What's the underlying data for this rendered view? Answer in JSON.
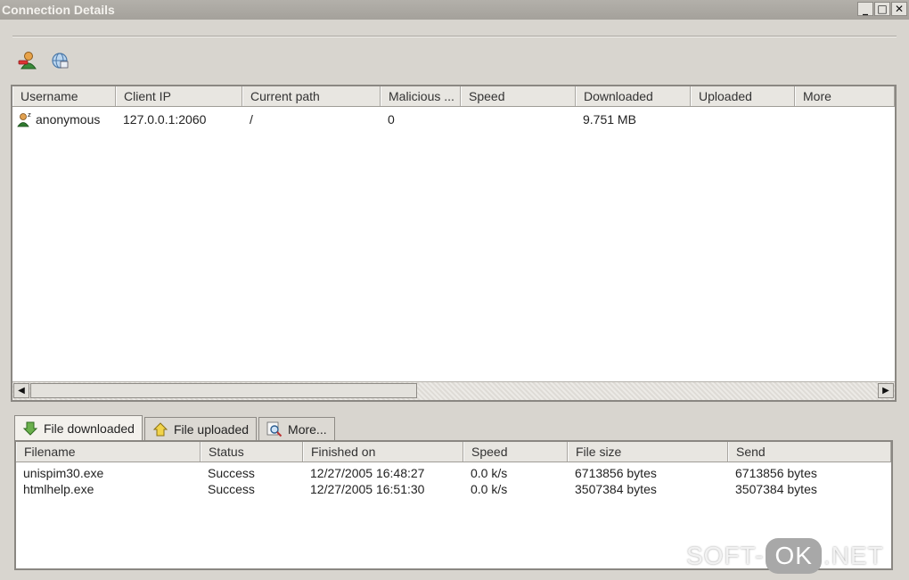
{
  "window": {
    "title": "Connection Details",
    "buttons": {
      "minimize": "_",
      "maximize": "□",
      "close": "✕"
    }
  },
  "toolbar": [
    {
      "icon": "disconnect-user-icon"
    },
    {
      "icon": "refresh-connection-icon"
    }
  ],
  "connections": {
    "columns": [
      "Username",
      "Client IP",
      "Current path",
      "Malicious ...",
      "Speed",
      "Downloaded",
      "Uploaded",
      "More"
    ],
    "rows": [
      {
        "username": "anonymous",
        "client_ip": "127.0.0.1:2060",
        "current_path": "/",
        "malicious": "0",
        "speed": "",
        "downloaded": "9.751 MB",
        "uploaded": "",
        "more": ""
      }
    ],
    "scrollbar": {
      "left": "◀",
      "right": "▶"
    }
  },
  "tabs": [
    {
      "label": "File downloaded",
      "icon": "download-arrow-icon",
      "active": true
    },
    {
      "label": "File uploaded",
      "icon": "upload-arrow-icon",
      "active": false
    },
    {
      "label": "More...",
      "icon": "magnifier-icon",
      "active": false
    }
  ],
  "transfers": {
    "columns": [
      "Filename",
      "Status",
      "Finished on",
      "Speed",
      "File size",
      "Send"
    ],
    "rows": [
      {
        "filename": "unispim30.exe",
        "status": "Success",
        "finished": "12/27/2005  16:48:27",
        "speed": "0.0 k/s",
        "size": "6713856 bytes",
        "send": "6713856 bytes"
      },
      {
        "filename": "htmlhelp.exe",
        "status": "Success",
        "finished": "12/27/2005  16:51:30",
        "speed": "0.0 k/s",
        "size": "3507384 bytes",
        "send": "3507384 bytes"
      }
    ]
  },
  "watermark": {
    "left": "SOFT-",
    "badge": "OK",
    "right": ".NET"
  }
}
